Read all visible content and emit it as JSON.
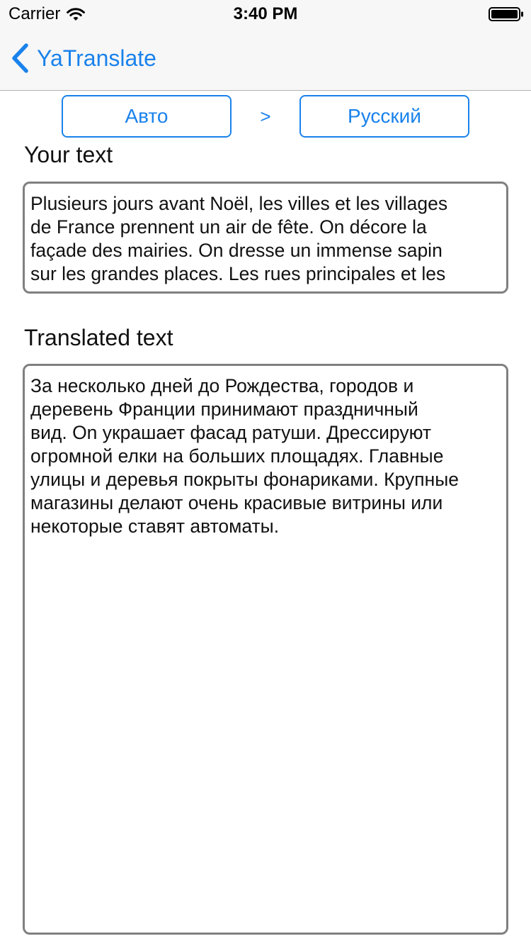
{
  "status_bar": {
    "carrier": "Carrier",
    "time": "3:40 PM"
  },
  "nav": {
    "back_label": "YaTranslate"
  },
  "languages": {
    "from": "Авто",
    "arrow": ">",
    "to": "Русский"
  },
  "input": {
    "label": "Your text",
    "text": "Plusieurs jours avant Noël, les villes et les villages\nde France prennent un air de fête. On décore la\nfaçade des mairies. On dresse un immense sapin\nsur les grandes places. Les rues principales et les"
  },
  "output": {
    "label": "Translated text",
    "text": "За несколько дней до Рождества, городов и\nдеревень Франции принимают праздничный\nвид. On украшает фасад ратуши. Дрессируют\nогромной елки на больших площадях. Главные\nулицы и деревья покрыты фонариками. Крупные\nмагазины делают очень красивые витрины или\nнекоторые ставят автоматы."
  },
  "colors": {
    "accent": "#1a82ec",
    "border": "#808080",
    "bar_background": "#f7f7f7"
  },
  "icons": {
    "wifi": "wifi-icon",
    "battery": "battery-icon",
    "back": "chevron-left-icon"
  }
}
